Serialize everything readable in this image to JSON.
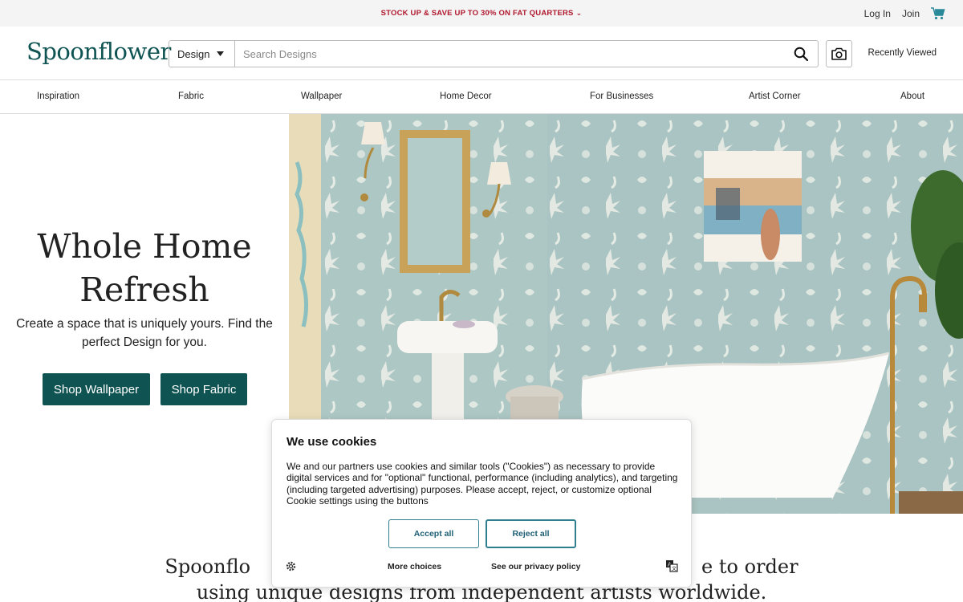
{
  "promo": {
    "text": "STOCK UP & SAVE UP TO 30% ON FAT QUARTERS",
    "chevron": "⌄"
  },
  "account": {
    "login": "Log In",
    "join": "Join",
    "cart_icon": "cart-icon"
  },
  "brand": {
    "logo": "Spoonflower",
    "color": "#0f5352"
  },
  "search": {
    "type_selected": "Design",
    "placeholder": "Search Designs"
  },
  "header": {
    "recently_viewed": "Recently Viewed"
  },
  "nav": [
    "Inspiration",
    "Fabric",
    "Wallpaper",
    "Home Decor",
    "For Businesses",
    "Artist Corner",
    "About"
  ],
  "hero": {
    "title_line1": "Whole Home",
    "title_line2": "Refresh",
    "subtitle": "Create a space that is uniquely yours. Find the perfect Design for you.",
    "btn_wallpaper": "Shop Wallpaper",
    "btn_fabric": "Shop Fabric"
  },
  "lower": {
    "line1_start": "Spoonflo",
    "line1_end": "e to order",
    "line2": "using unique designs from independent artists worldwide."
  },
  "cookie": {
    "title": "We use cookies",
    "body": "We and our partners use cookies and similar tools (\"Cookies\") as necessary to provide digital services and for \"optional\" functional, performance (including analytics), and targeting (including targeted advertising) purposes. Please accept, reject, or customize optional Cookie settings using the buttons",
    "accept": "Accept all",
    "reject": "Reject all",
    "more": "More choices",
    "privacy": "See our privacy policy"
  }
}
